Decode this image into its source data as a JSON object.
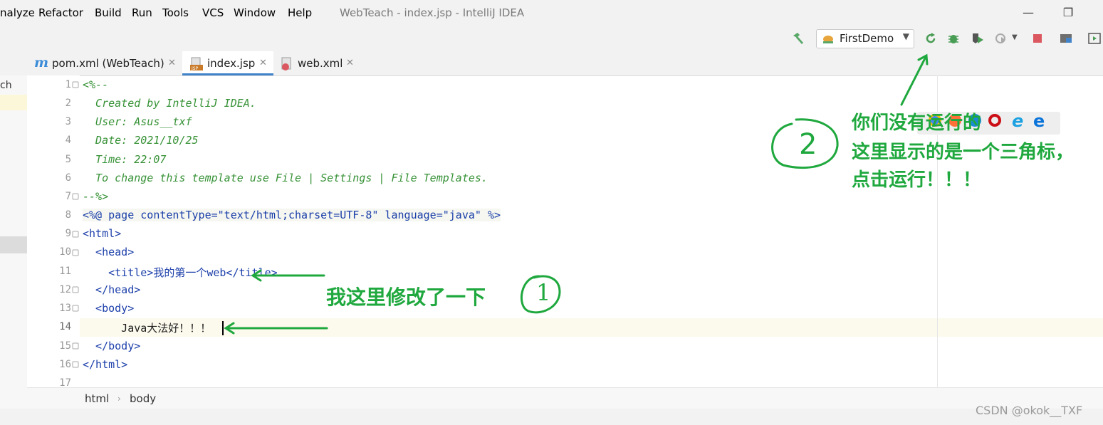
{
  "window": {
    "title": "WebTeach - index.jsp - IntelliJ IDEA"
  },
  "menu": {
    "items": [
      "nalyze",
      "Refactor",
      "Build",
      "Run",
      "Tools",
      "VCS",
      "Window",
      "Help"
    ]
  },
  "toolbar": {
    "run_config": "FirstDemo"
  },
  "tabs": [
    {
      "label": "pom.xml (WebTeach)",
      "icon": "maven-icon"
    },
    {
      "label": "index.jsp",
      "icon": "jsp-file-icon",
      "active": true
    },
    {
      "label": "web.xml",
      "icon": "xml-file-icon"
    }
  ],
  "left_panel": {
    "label": "ch"
  },
  "editor": {
    "current_line": 14,
    "lines": [
      {
        "n": "1",
        "text": "<%--"
      },
      {
        "n": "2",
        "text": "  Created by IntelliJ IDEA."
      },
      {
        "n": "3",
        "text": "  User: Asus__txf"
      },
      {
        "n": "4",
        "text": "  Date: 2021/10/25"
      },
      {
        "n": "5",
        "text": "  Time: 22:07"
      },
      {
        "n": "6",
        "text": "  To change this template use File | Settings | File Templates."
      },
      {
        "n": "7",
        "text": "--%>"
      },
      {
        "n": "8",
        "text": "<%@ page contentType=\"text/html;charset=UTF-8\" language=\"java\" %>"
      },
      {
        "n": "9",
        "text": "<html>"
      },
      {
        "n": "10",
        "text": "  <head>"
      },
      {
        "n": "11",
        "text": "    <title>我的第一个web</title>"
      },
      {
        "n": "12",
        "text": "  </head>"
      },
      {
        "n": "13",
        "text": "  <body>"
      },
      {
        "n": "14",
        "text": "      Java大法好！！！"
      },
      {
        "n": "15",
        "text": "  </body>"
      },
      {
        "n": "16",
        "text": "</html>"
      },
      {
        "n": "17",
        "text": ""
      }
    ]
  },
  "breadcrumb": [
    "html",
    "body"
  ],
  "annotations": {
    "note1": "我这里修改了一下",
    "circle1": "1",
    "note2_line1": "你们没有运行的",
    "note2_line2": "这里显示的是一个三角标，",
    "note2_line3": "点击运行！！！",
    "circle2": "2"
  },
  "watermark": "CSDN @okok__TXF",
  "colors": {
    "annotation_green": "#1fa83e",
    "tab_underline": "#4083c9",
    "comment": "#379237",
    "tag": "#1c3faa"
  }
}
